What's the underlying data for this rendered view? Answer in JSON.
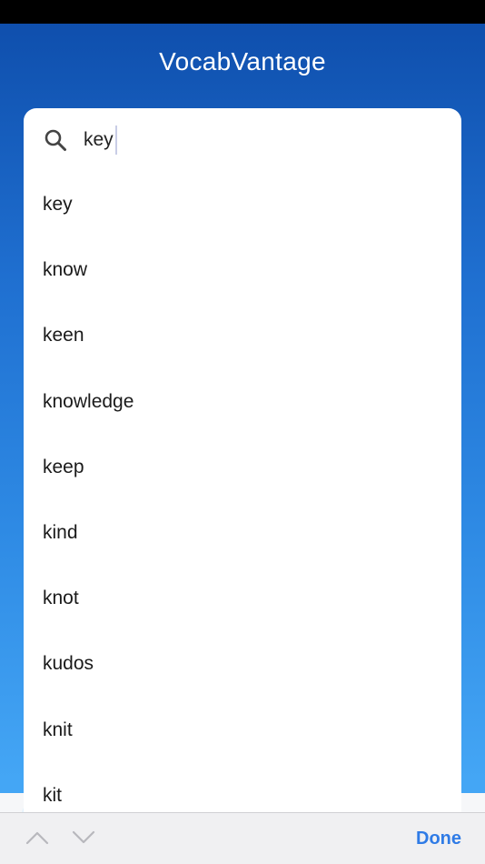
{
  "app": {
    "title": "VocabVantage"
  },
  "search": {
    "value": "key",
    "icon": "search-icon"
  },
  "suggestions": [
    "key",
    "know",
    "keen",
    "knowledge",
    "keep",
    "kind",
    "knot",
    "kudos",
    "knit",
    "kit"
  ],
  "keyboard_toolbar": {
    "prev_icon": "chevron-up-icon",
    "next_icon": "chevron-down-icon",
    "done_label": "Done"
  },
  "colors": {
    "gradient_top": "#0f4fad",
    "gradient_bottom": "#44a6f5",
    "accent": "#2f7be6",
    "arrows_disabled": "#b8b8bd"
  }
}
